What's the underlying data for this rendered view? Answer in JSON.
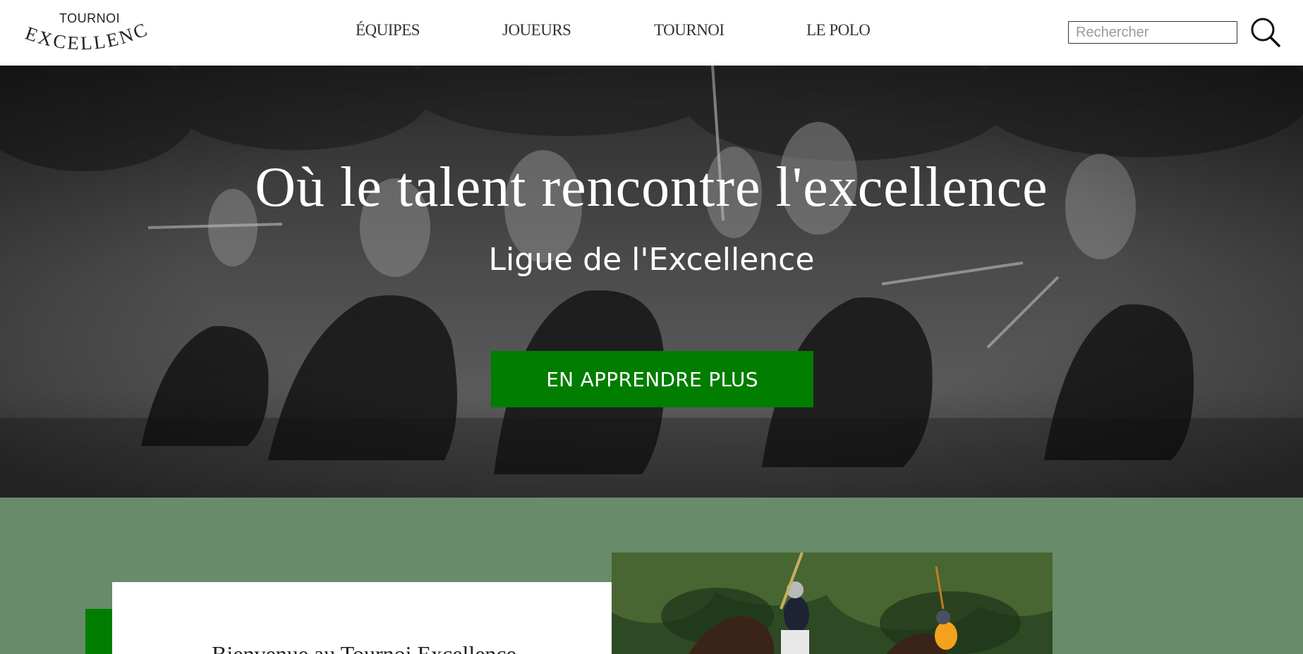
{
  "header": {
    "logo": {
      "top_word": "TOURNOI",
      "main_word": "EXCELLENCE"
    },
    "nav": [
      {
        "label": "ÉQUIPES"
      },
      {
        "label": "JOUEURS"
      },
      {
        "label": "TOURNOI"
      },
      {
        "label": "LE POLO"
      }
    ],
    "search": {
      "placeholder": "Rechercher",
      "value": ""
    },
    "icons": {
      "search": "search-icon"
    }
  },
  "hero": {
    "title": "Où le talent rencontre l'excellence",
    "subtitle": "Ligue de l'Excellence",
    "cta_label": "EN APPRENDRE PLUS"
  },
  "intro": {
    "title": "Bienvenue au Tournoi Excellence"
  },
  "colors": {
    "brand_green": "#017d00",
    "section_green": "#688c69",
    "header_bg": "#ffffff"
  }
}
